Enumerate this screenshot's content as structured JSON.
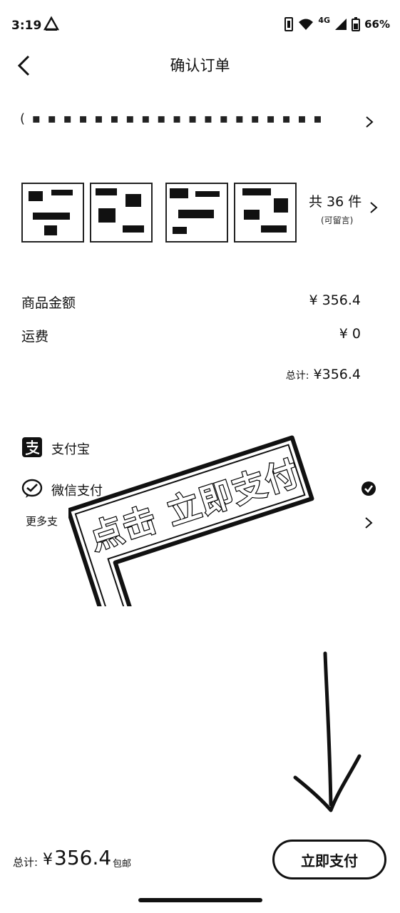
{
  "status_bar": {
    "time": "3:19",
    "network": "4G",
    "battery": "66%"
  },
  "header": {
    "title": "确认订单"
  },
  "address": {
    "text": "( ▪ ▪ ▪ ▪ ▪ ▪ ▪ ▪ ▪ ▪ ▪ ▪ ▪ ▪ ▪ ▪ ▪ ▪ ▪"
  },
  "goods": {
    "count_label": "共 36 件",
    "note_label": "(可留言)"
  },
  "prices": {
    "items_label": "商品金额",
    "items_value": "¥ 356.4",
    "shipping_label": "运费",
    "shipping_value": "¥ 0",
    "subtotal_label": "总计:",
    "subtotal_value": "¥356.4"
  },
  "payment": {
    "alipay_label": "支付宝",
    "wechat_label": "微信支付",
    "more_label": "更多支"
  },
  "overlay": {
    "stamp_text": "点击 立即支付"
  },
  "footer": {
    "total_label": "总计:",
    "currency": "¥",
    "total_value": "356.4",
    "free_shipping": "包邮",
    "pay_button": "立即支付"
  }
}
